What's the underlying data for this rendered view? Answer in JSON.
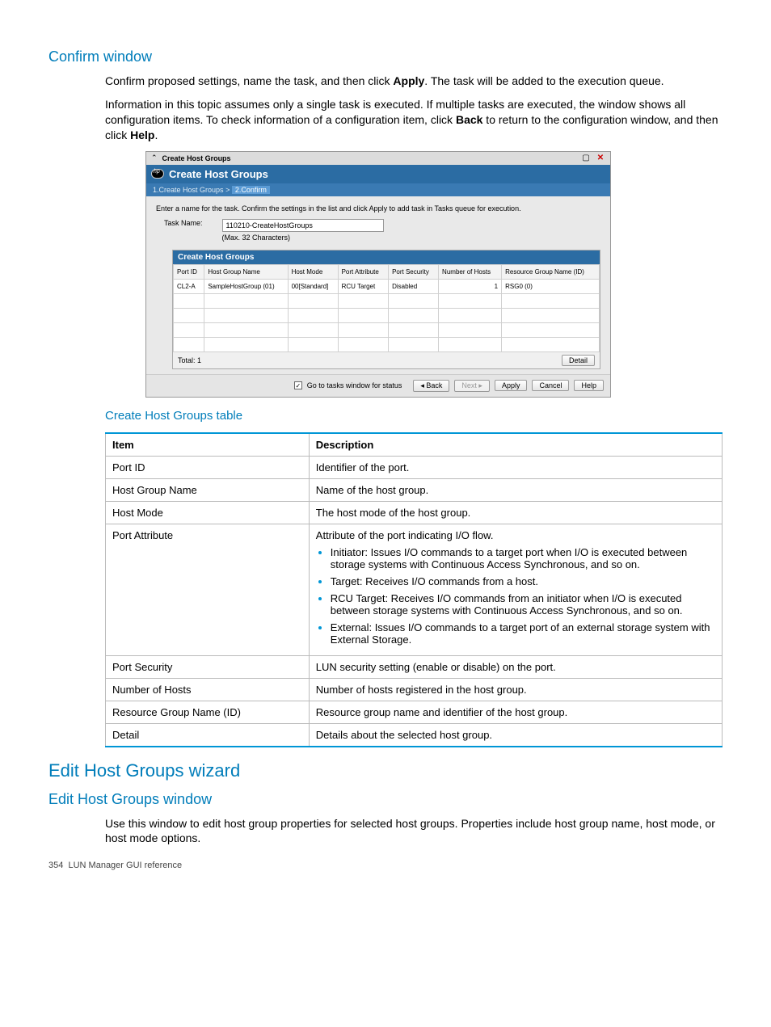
{
  "sections": {
    "confirm_heading": "Confirm window",
    "confirm_p1_a": "Confirm proposed settings, name the task, and then click ",
    "confirm_p1_b": "Apply",
    "confirm_p1_c": ". The task will be added to the execution queue.",
    "confirm_p2_a": "Information in this topic assumes only a single task is executed. If multiple tasks are executed, the window shows all configuration items. To check information of a configuration item, click ",
    "confirm_p2_b": "Back",
    "confirm_p2_c": " to return to the configuration window, and then click ",
    "confirm_p2_d": "Help",
    "confirm_p2_e": "."
  },
  "win": {
    "titlebar": "Create Host Groups",
    "header_title": "Create Host Groups",
    "breadcrumb_step1": "1.Create Host Groups",
    "breadcrumb_sep": ">",
    "breadcrumb_step2": "2.Confirm",
    "instruction": "Enter a name for the task. Confirm the settings in the list and click Apply to add task in Tasks queue for execution.",
    "task_name_label": "Task Name:",
    "task_name_value": "110210-CreateHostGroups",
    "task_name_hint": "(Max. 32 Characters)",
    "inner_title": "Create Host Groups",
    "headers": {
      "port_id": "Port ID",
      "hg_name": "Host Group Name",
      "host_mode": "Host Mode",
      "port_attr": "Port Attribute",
      "port_sec": "Port Security",
      "num_hosts": "Number of Hosts",
      "rg": "Resource Group Name (ID)"
    },
    "row": {
      "port_id": "CL2-A",
      "hg_name": "SampleHostGroup (01)",
      "host_mode": "00[Standard]",
      "port_attr": "RCU Target",
      "port_sec": "Disabled",
      "num_hosts": "1",
      "rg": "RSG0 (0)"
    },
    "total_label": "Total: 1",
    "detail_btn": "Detail",
    "footer": {
      "checkbox_label": "Go to tasks window for status",
      "back": "Back",
      "next": "Next",
      "apply": "Apply",
      "cancel": "Cancel",
      "help": "Help"
    }
  },
  "table": {
    "heading": "Create Host Groups table",
    "th_item": "Item",
    "th_desc": "Description",
    "rows": {
      "port_id": {
        "item": "Port ID",
        "desc": "Identifier of the port."
      },
      "hg_name": {
        "item": "Host Group Name",
        "desc": "Name of the host group."
      },
      "host_mode": {
        "item": "Host Mode",
        "desc": "The host mode of the host group."
      },
      "port_attr": {
        "item": "Port Attribute",
        "desc_intro": "Attribute of the port indicating I/O flow.",
        "b1": "Initiator: Issues I/O commands to a target port when I/O is executed between storage systems with Continuous Access Synchronous, and so on.",
        "b2": "Target: Receives I/O commands from a host.",
        "b3": "RCU Target: Receives I/O commands from an initiator when I/O is executed between storage systems with Continuous Access Synchronous, and so on.",
        "b4": "External: Issues I/O commands to a target port of an external storage system with External Storage."
      },
      "port_sec": {
        "item": "Port Security",
        "desc": "LUN security setting (enable or disable) on the port."
      },
      "num_hosts": {
        "item": "Number of Hosts",
        "desc": "Number of hosts registered in the host group."
      },
      "rg": {
        "item": "Resource Group Name (ID)",
        "desc": "Resource group name and identifier of the host group."
      },
      "detail": {
        "item": "Detail",
        "desc": "Details about the selected host group."
      }
    }
  },
  "edit_section": {
    "heading1": "Edit Host Groups wizard",
    "heading2": "Edit Host Groups window",
    "para": "Use this window to edit host group properties for selected host groups. Properties include host group name, host mode, or host mode options."
  },
  "footer": {
    "page": "354",
    "label": "LUN Manager GUI reference"
  }
}
